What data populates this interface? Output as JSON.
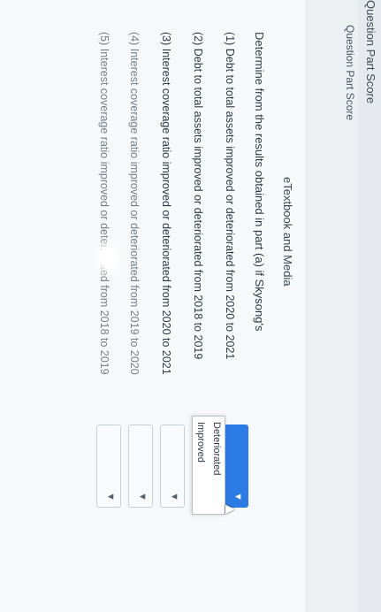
{
  "header": {
    "title": "Question Part Score"
  },
  "sidebar": {
    "question_part_score": "Question Part Score",
    "etextbook": "eTextbook and Media"
  },
  "question": {
    "prompt": "Determine from the results obtained in part (a) if Skysong's",
    "items": [
      {
        "label": "(1) Debt to total assets improved or deteriorated from 2020 to 2021",
        "selected": ""
      },
      {
        "label": "(2) Debt to total assets improved or deteriorated from 2018 to 2019",
        "selected": ""
      },
      {
        "label": "(3) Interest coverage ratio improved or deteriorated from 2020 to 2021",
        "selected": ""
      },
      {
        "label": "(4) Interest coverage ratio improved or deteriorated from 2019 to 2020",
        "selected": ""
      },
      {
        "label": "(5) Interest coverage ratio improved or deteriorated from 2018 to 2019",
        "selected": ""
      }
    ],
    "dropdown_options": [
      "Deteriorated",
      "Improved"
    ]
  },
  "icons": {
    "chevron": "chevron-down-icon",
    "cursor": "mouse-pointer-icon"
  },
  "colors": {
    "accent": "#2d7be5",
    "text": "#2f3944",
    "panel": "#edf0f3"
  }
}
